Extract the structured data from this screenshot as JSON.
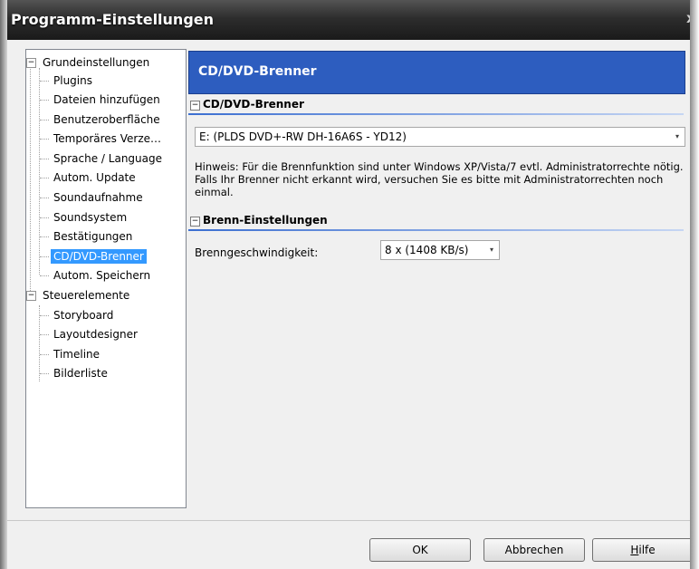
{
  "window": {
    "title": "Programm-Einstellungen",
    "close_label": "x"
  },
  "tree": {
    "groups": [
      {
        "label": "Grundeinstellungen",
        "expander": "−",
        "items": [
          "Plugins",
          "Dateien hinzufügen",
          "Benutzeroberfläche",
          "Temporäres Verze…",
          "Sprache / Language",
          "Autom. Update",
          "Soundaufnahme",
          "Soundsystem",
          "Bestätigungen",
          "CD/DVD-Brenner",
          "Autom. Speichern"
        ]
      },
      {
        "label": "Steuerelemente",
        "expander": "−",
        "items": [
          "Storyboard",
          "Layoutdesigner",
          "Timeline",
          "Bilderliste"
        ]
      }
    ],
    "selected": "CD/DVD-Brenner"
  },
  "panel": {
    "header": "CD/DVD-Brenner",
    "section1": {
      "title": "CD/DVD-Brenner",
      "expander": "−",
      "drive_value": "E: (PLDS DVD+-RW DH-16A6S - YD12)",
      "hint": "Hinweis: Für die Brennfunktion sind unter Windows XP/Vista/7 evtl. Administratorrechte nötig. Falls Ihr Brenner nicht erkannt wird, versuchen Sie es bitte mit Administratorrechten noch einmal."
    },
    "section2": {
      "title": "Brenn-Einstellungen",
      "expander": "−",
      "speed_label": "Brenngeschwindigkeit:",
      "speed_value": "8 x (1408 KB/s)"
    }
  },
  "buttons": {
    "ok": "OK",
    "cancel": "Abbrechen",
    "help_first": "H",
    "help_rest": "ilfe"
  },
  "icons": {
    "dropdown_arrow": "▾"
  }
}
